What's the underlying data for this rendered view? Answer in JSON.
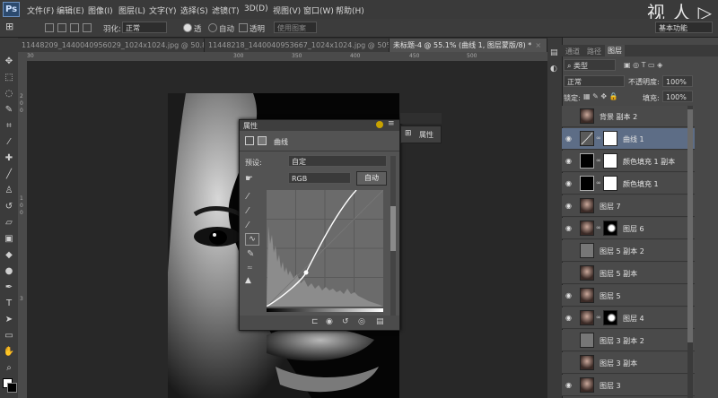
{
  "menubar": {
    "logo": "Ps",
    "items": [
      "文件(F)",
      "编辑(E)",
      "图像(I)",
      "图层(L)",
      "文字(Y)",
      "选择(S)",
      "滤镜(T)",
      "3D(D)",
      "视图(V)",
      "窗口(W)",
      "帮助(H)"
    ],
    "watermark": "视 人 ▷"
  },
  "options": {
    "feather_label": "羽化:",
    "mode_label": "正常",
    "gradient_a_label": "透",
    "gradient_b_label": "自动",
    "transparent_label": "透明",
    "use_label": "使用图案",
    "workspace": "基本功能"
  },
  "tabs": [
    {
      "label": "11448209_1440040956029_1024x1024.jpg @ 50.8...",
      "active": false
    },
    {
      "label": "11448218_1440040953667_1024x1024.jpg @ 50%...",
      "active": false
    },
    {
      "label": "未标题-4 @ 55.1% (曲线 1, 图层蒙版/8) *",
      "active": true
    }
  ],
  "ruler": {
    "top": [
      "30",
      "300",
      "350",
      "400",
      "450",
      "500"
    ],
    "left": [
      "2",
      "0",
      "0",
      "1",
      "0",
      "0",
      "3"
    ]
  },
  "properties": {
    "title": "属性",
    "section": "曲线",
    "preset_label": "预设:",
    "preset_value": "自定",
    "channel_value": "RGB",
    "auto_button": "自动",
    "mini_panel_label": "属性"
  },
  "panel_tabs": [
    "通道",
    "路径",
    "图层"
  ],
  "layers_panel": {
    "kind_label": "类型",
    "blend_mode": "正常",
    "opacity_label": "不透明度:",
    "opacity_value": "100%",
    "lock_label": "锁定:",
    "fill_label": "填充:",
    "fill_value": "100%",
    "layers": [
      {
        "name": "背景 副本 2",
        "visible": false,
        "thumb": "face",
        "selected": false
      },
      {
        "name": "曲线 1",
        "visible": true,
        "thumb": "curves",
        "selected": true
      },
      {
        "name": "颜色填充 1 副本",
        "visible": true,
        "thumb": "fill",
        "selected": false
      },
      {
        "name": "颜色填充 1",
        "visible": true,
        "thumb": "fill",
        "selected": false
      },
      {
        "name": "图层 7",
        "visible": true,
        "thumb": "face",
        "selected": false
      },
      {
        "name": "图层 6",
        "visible": true,
        "thumb": "face-mask",
        "selected": false
      },
      {
        "name": "图层 5 副本 2",
        "visible": false,
        "thumb": "gray",
        "selected": false
      },
      {
        "name": "图层 5 副本",
        "visible": false,
        "thumb": "face",
        "selected": false
      },
      {
        "name": "图层 5",
        "visible": true,
        "thumb": "face",
        "selected": false
      },
      {
        "name": "图层 4",
        "visible": true,
        "thumb": "face-mask",
        "selected": false
      },
      {
        "name": "图层 3 副本 2",
        "visible": false,
        "thumb": "gray",
        "selected": false
      },
      {
        "name": "图层 3 副本",
        "visible": false,
        "thumb": "face",
        "selected": false
      },
      {
        "name": "图层 3",
        "visible": true,
        "thumb": "face",
        "selected": false
      }
    ]
  },
  "colors": {
    "accent_selected": "#5d6d86",
    "panel_bg": "#535353",
    "app_bg": "#282828"
  }
}
